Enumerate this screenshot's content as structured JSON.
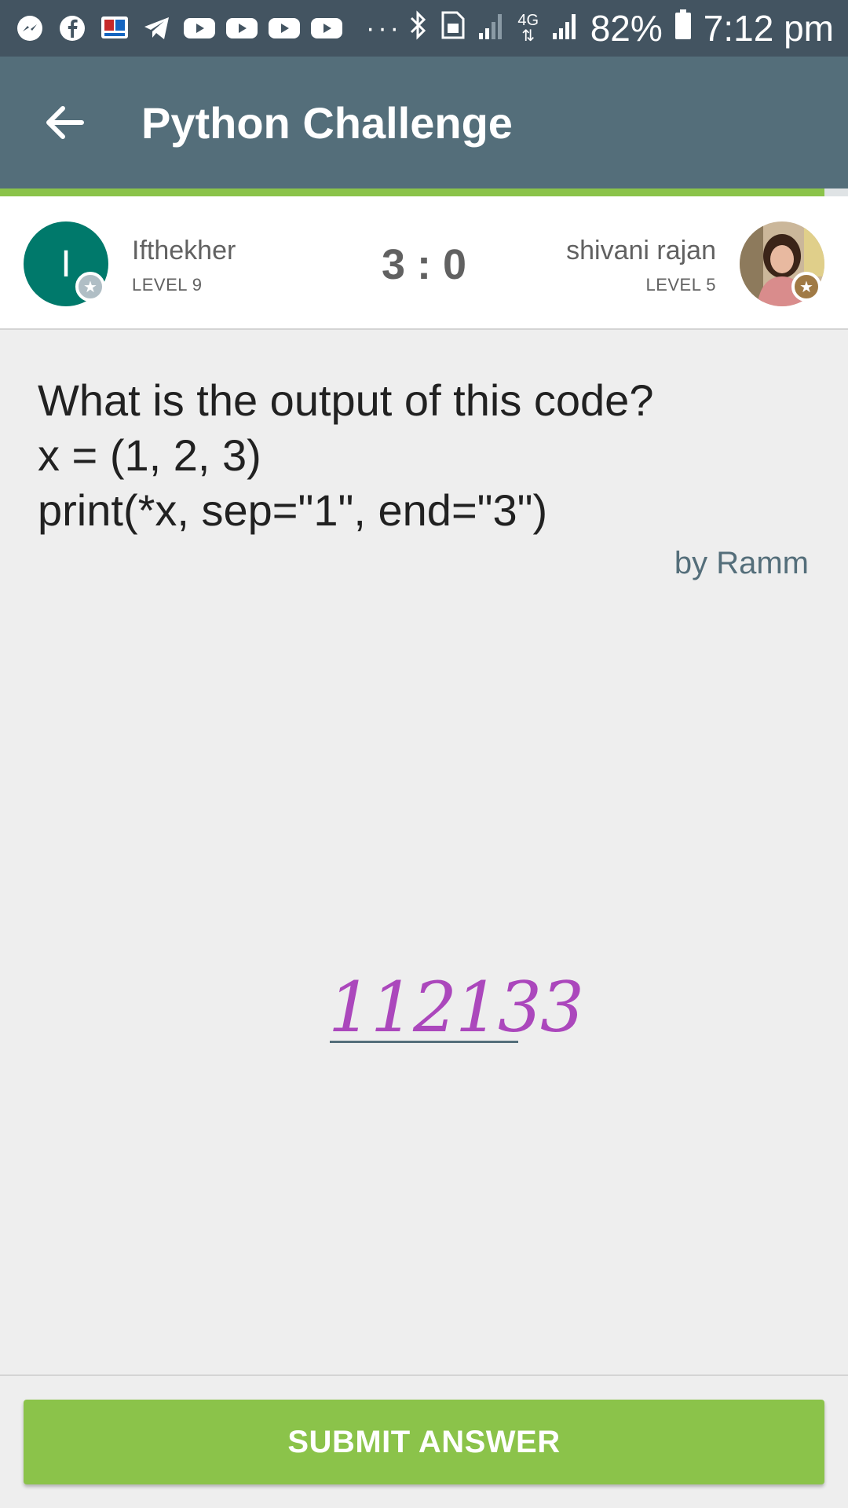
{
  "status_bar": {
    "notification_icons": [
      "messenger-icon",
      "facebook-icon",
      "app-icon",
      "telegram-icon",
      "youtube-icon",
      "youtube-icon",
      "youtube-icon",
      "youtube-icon"
    ],
    "more": "···",
    "network_label": "4G",
    "battery": "82%",
    "time": "7:12 pm"
  },
  "app_bar": {
    "title": "Python Challenge",
    "background": "#546e7a"
  },
  "players": {
    "left": {
      "initial": "I",
      "name": "Ifthekher",
      "level": "LEVEL 9",
      "avatar_color": "#00796b"
    },
    "score": "3 : 0",
    "right": {
      "name": "shivani rajan",
      "level": "LEVEL 5"
    }
  },
  "question": {
    "lines": [
      "What is the output of this code?",
      "x = (1, 2, 3)",
      "print(*x, sep=\"1\", end=\"3\")"
    ],
    "author": "by Ramm"
  },
  "answer": {
    "value": "112133",
    "color": "#ab47bc"
  },
  "submit": {
    "label": "SUBMIT ANSWER",
    "color": "#8bc34a"
  }
}
